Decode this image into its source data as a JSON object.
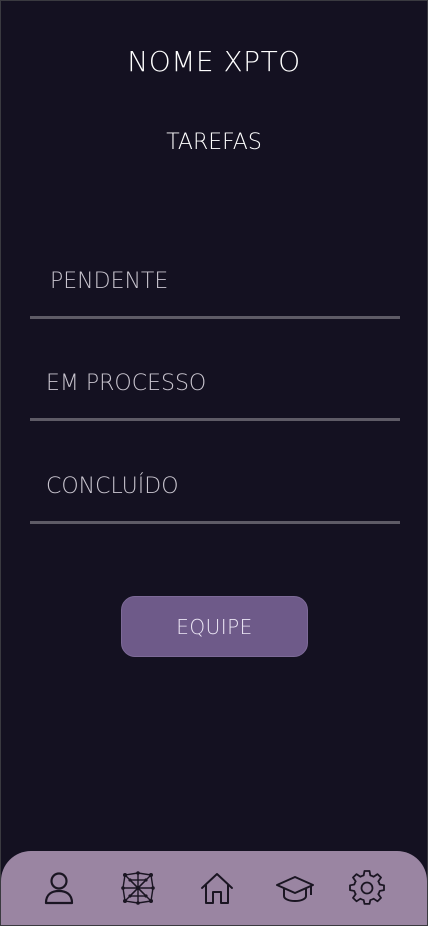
{
  "header": {
    "title": "NOME XPTO",
    "subtitle": "TAREFAS"
  },
  "tasks": {
    "items": [
      {
        "label": "PENDENTE"
      },
      {
        "label": "EM PROCESSO"
      },
      {
        "label": "CONCLUÍDO"
      }
    ]
  },
  "actions": {
    "team_label": "EQUIPE"
  },
  "bottom_nav": {
    "items": [
      {
        "icon": "user-icon"
      },
      {
        "icon": "network-icon"
      },
      {
        "icon": "home-icon"
      },
      {
        "icon": "graduation-cap-icon"
      },
      {
        "icon": "gear-icon"
      }
    ]
  },
  "colors": {
    "background": "#141121",
    "accent": "#6e5a89",
    "nav_background": "#9a85a2",
    "divider": "#5e5b66"
  }
}
